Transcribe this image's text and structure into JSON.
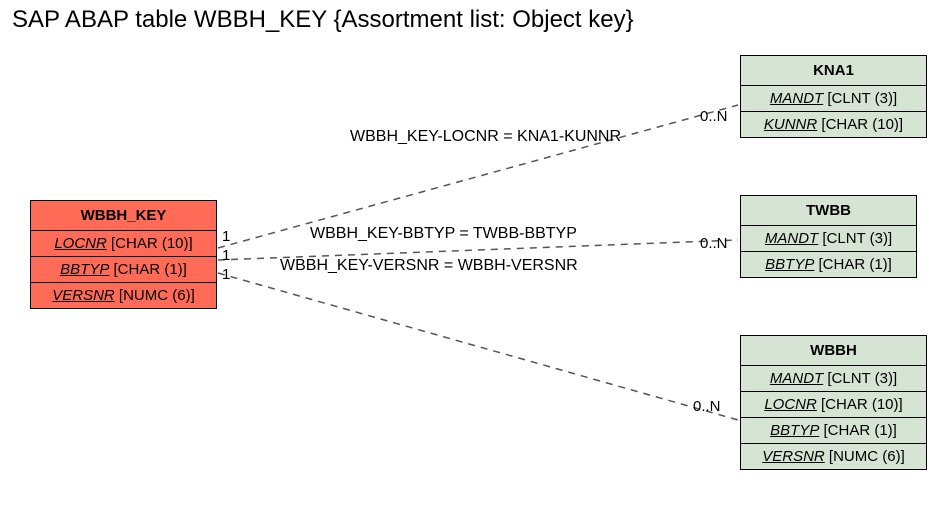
{
  "title": "SAP ABAP table WBBH_KEY {Assortment list: Object key}",
  "entities": {
    "main": {
      "name": "WBBH_KEY",
      "fields": [
        {
          "name": "LOCNR",
          "type": "[CHAR (10)]"
        },
        {
          "name": "BBTYP",
          "type": "[CHAR (1)]"
        },
        {
          "name": "VERSNR",
          "type": "[NUMC (6)]"
        }
      ]
    },
    "kna1": {
      "name": "KNA1",
      "fields": [
        {
          "name": "MANDT",
          "type": "[CLNT (3)]"
        },
        {
          "name": "KUNNR",
          "type": "[CHAR (10)]"
        }
      ]
    },
    "twbb": {
      "name": "TWBB",
      "fields": [
        {
          "name": "MANDT",
          "type": "[CLNT (3)]"
        },
        {
          "name": "BBTYP",
          "type": "[CHAR (1)]"
        }
      ]
    },
    "wbbh": {
      "name": "WBBH",
      "fields": [
        {
          "name": "MANDT",
          "type": "[CLNT (3)]"
        },
        {
          "name": "LOCNR",
          "type": "[CHAR (10)]"
        },
        {
          "name": "BBTYP",
          "type": "[CHAR (1)]"
        },
        {
          "name": "VERSNR",
          "type": "[NUMC (6)]"
        }
      ]
    }
  },
  "edges": {
    "e1": {
      "label": "WBBH_KEY-LOCNR = KNA1-KUNNR",
      "card_left": "1",
      "card_right": "0..N"
    },
    "e2": {
      "label": "WBBH_KEY-BBTYP = TWBB-BBTYP",
      "card_left": "1",
      "card_right": "0..N"
    },
    "e3": {
      "label": "WBBH_KEY-VERSNR = WBBH-VERSNR",
      "card_left": "1",
      "card_right": ""
    },
    "e4": {
      "label": "",
      "card_left": "",
      "card_right": "0..N"
    }
  }
}
